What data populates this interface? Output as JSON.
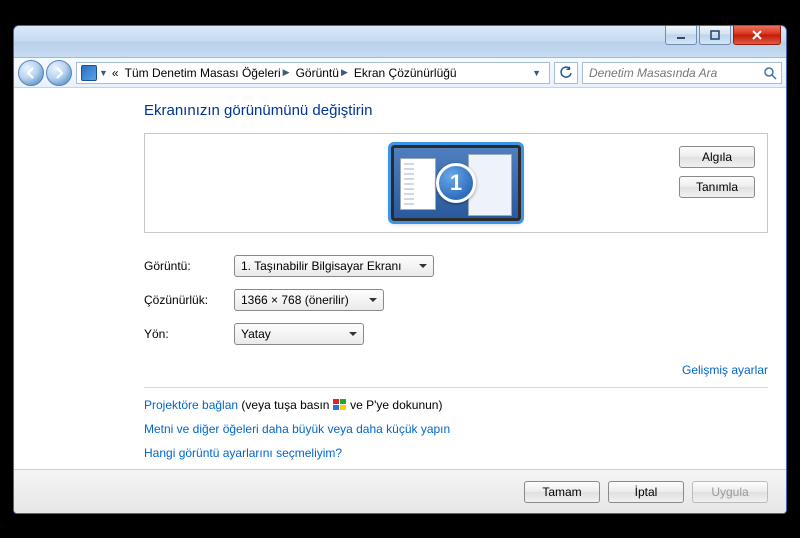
{
  "titlebar": {},
  "breadcrumb": {
    "sep": "«",
    "items": [
      "Tüm Denetim Masası Öğeleri",
      "Görüntü",
      "Ekran Çözünürlüğü"
    ]
  },
  "search": {
    "placeholder": "Denetim Masasında Ara"
  },
  "heading": "Ekranınızın görünümünü değiştirin",
  "monitor_number": "1",
  "side_buttons": {
    "detect": "Algıla",
    "identify": "Tanımla"
  },
  "form": {
    "display_label": "Görüntü:",
    "display_value": "1. Taşınabilir Bilgisayar Ekranı",
    "resolution_label": "Çözünürlük:",
    "resolution_value": "1366 × 768 (önerilir)",
    "orientation_label": "Yön:",
    "orientation_value": "Yatay"
  },
  "advanced_link": "Gelişmiş ayarlar",
  "help": {
    "projector_link": "Projektöre bağlan",
    "projector_rest_a": " (veya tuşa basın ",
    "projector_rest_b": " ve P'ye dokunun)",
    "textsize_link": "Metni ve diğer öğeleri daha büyük veya daha küçük yapın",
    "which_link": "Hangi görüntü ayarlarını seçmeliyim?"
  },
  "buttons": {
    "ok": "Tamam",
    "cancel": "İptal",
    "apply": "Uygula"
  }
}
